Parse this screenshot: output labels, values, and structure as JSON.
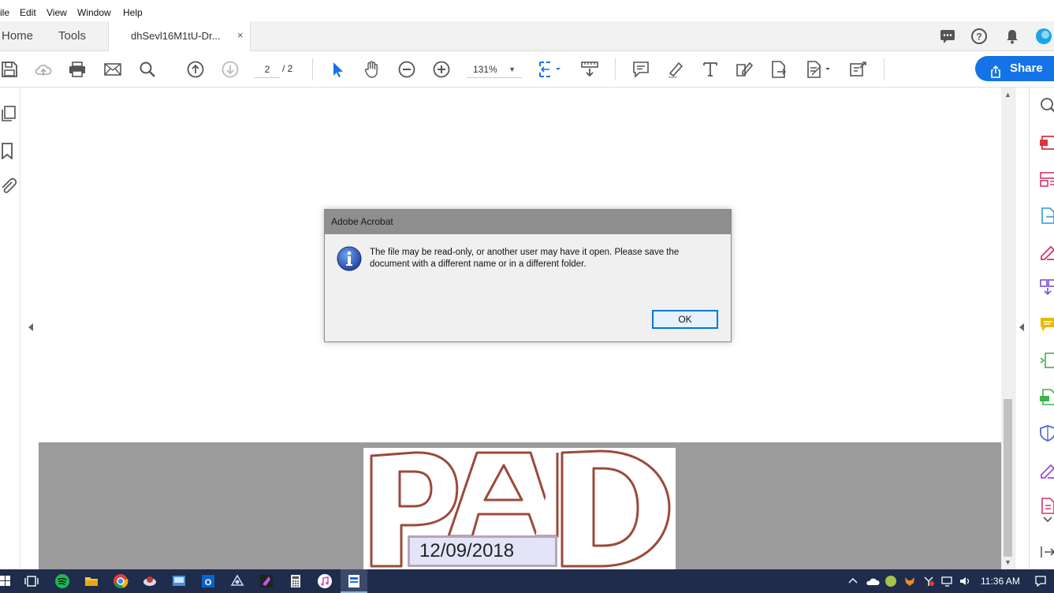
{
  "menubar": {
    "items": [
      "ile",
      "Edit",
      "View",
      "Window",
      "Help"
    ]
  },
  "tabs": {
    "home": "Home",
    "tools": "Tools",
    "document": "dhSevl16M1tU-Dr...",
    "close": "×"
  },
  "toolbar": {
    "page_current": "2",
    "page_total": "/ 2",
    "zoom": "131%",
    "share_label": "Share",
    "icons": [
      "save-icon",
      "upload-icon",
      "print-icon",
      "mail-icon",
      "search-icon",
      "page-up-icon",
      "page-down-icon",
      "select-arrow-icon",
      "hand-icon",
      "zoom-out-icon",
      "zoom-in-icon",
      "fit-page-icon",
      "scroll-mode-icon",
      "comment-icon",
      "highlight-icon",
      "text-icon",
      "edit-icon",
      "export-icon",
      "fill-sign-icon",
      "more-tools-icon"
    ]
  },
  "header_icons": [
    "chat-icon",
    "help-icon",
    "bell-icon",
    "account-icon"
  ],
  "left_panel": {
    "icons": [
      "pages-icon",
      "bookmark-icon",
      "attachment-icon"
    ]
  },
  "right_panel": {
    "icons": [
      "search-doc-icon",
      "create-pdf-icon",
      "organize-icon",
      "export-pdf-icon",
      "edit-pdf-icon",
      "combine-icon",
      "comment-icon",
      "compress-icon",
      "print-production-icon",
      "protect-icon",
      "fill-sign-icon",
      "more-icon"
    ],
    "colors": [
      "#e0343d",
      "#d6336c",
      "#2b9ad8",
      "#d6336c",
      "#7b4fd6",
      "#e8b800",
      "#3db34a",
      "#3db34a",
      "#4b6ed1",
      "#9b4fd6",
      "#d6336c"
    ]
  },
  "stamp": {
    "text": "PAID",
    "date": "12/09/2018",
    "stroke_color": "#9a4a3c"
  },
  "dialog": {
    "title": "Adobe Acrobat",
    "message": "The file may be read-only, or another user may have it open. Please save the document with a different name or in a different folder.",
    "ok": "OK"
  },
  "taskbar": {
    "time": "11:36 AM",
    "apps": [
      "task-view-icon",
      "spotify-icon",
      "file-explorer-icon",
      "chrome-icon",
      "app-icon",
      "control-panel-icon",
      "outlook-icon",
      "vpn-icon",
      "visual-studio-icon",
      "calculator-icon",
      "itunes-icon",
      "acrobat-icon"
    ]
  }
}
